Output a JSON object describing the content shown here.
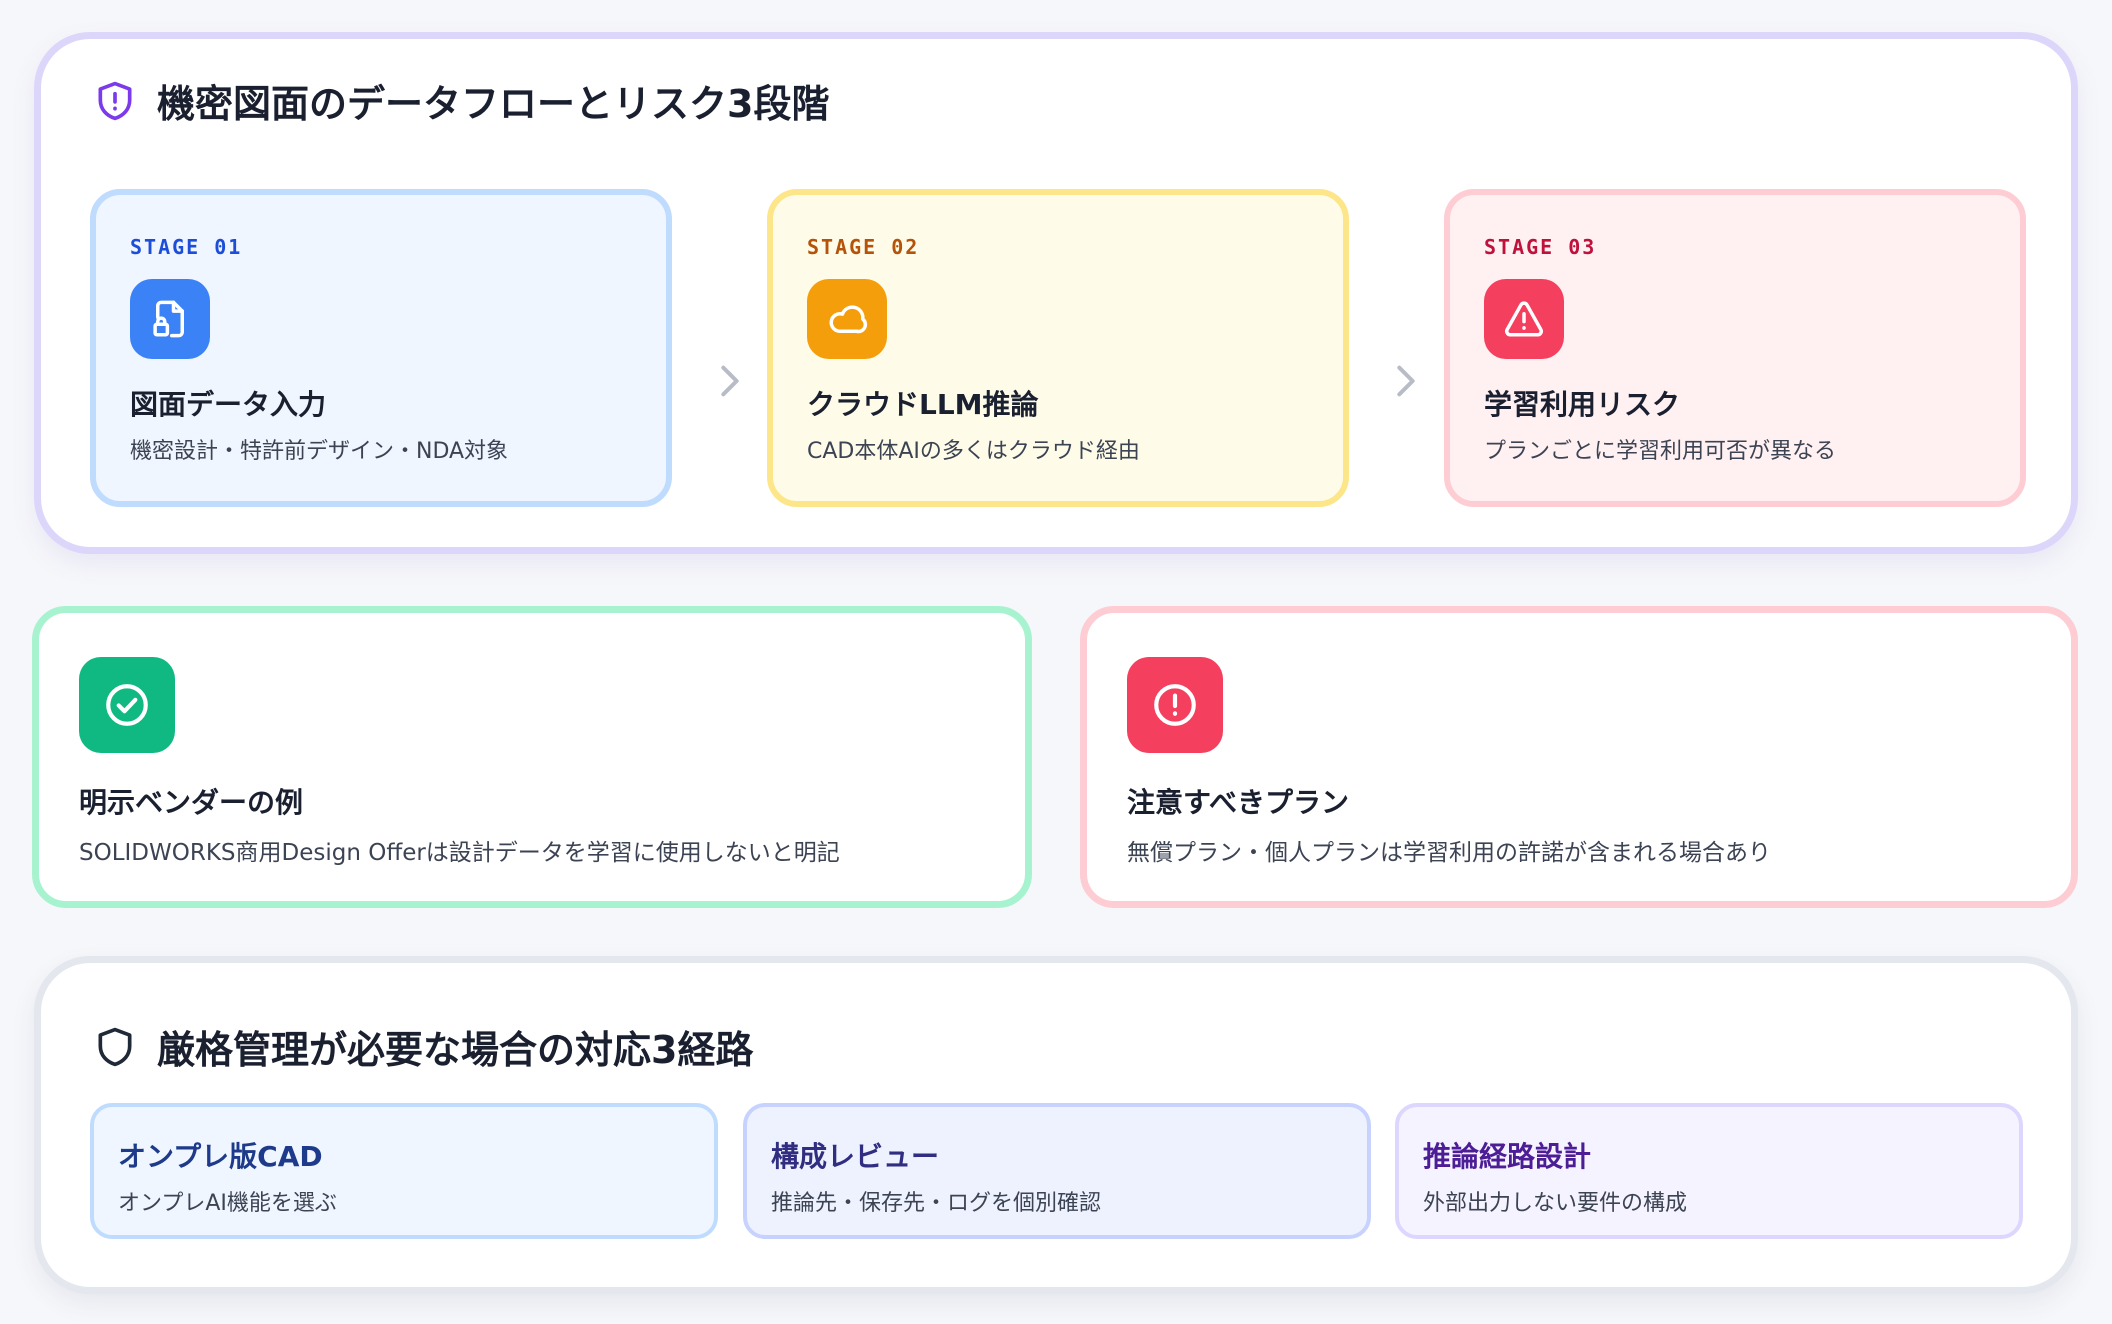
{
  "flow": {
    "title": "機密図面のデータフローとリスク3段階",
    "title_icon": "shield-alert-icon",
    "stages": [
      {
        "label": "STAGE 01",
        "icon": "file-lock-icon",
        "title": "図面データ入力",
        "desc": "機密設計・特許前デザイン・NDA対象",
        "accent": "#1d4ed8",
        "icon_bg": "#3b82f6",
        "bg": "#eff6ff",
        "border": "#bfdbfe"
      },
      {
        "label": "STAGE 02",
        "icon": "cloud-icon",
        "title": "クラウドLLM推論",
        "desc": "CAD本体AIの多くはクラウド経由",
        "accent": "#b45309",
        "icon_bg": "#f59e0b",
        "bg": "#fefce8",
        "border": "#fde68a"
      },
      {
        "label": "STAGE 03",
        "icon": "warning-triangle-icon",
        "title": "学習利用リスク",
        "desc": "プランごとに学習利用可否が異なる",
        "accent": "#be123c",
        "icon_bg": "#f43f5e",
        "bg": "#fff1f2",
        "border": "#fecdd3"
      }
    ]
  },
  "info": [
    {
      "icon": "check-circle-icon",
      "title": "明示ベンダーの例",
      "desc": "SOLIDWORKS商用Design Offerは設計データを学習に使用しないと明記",
      "icon_bg": "#10b981",
      "border": "#a7f3d0"
    },
    {
      "icon": "alert-circle-icon",
      "title": "注意すべきプラン",
      "desc": "無償プラン・個人プランは学習利用の許諾が含まれる場合あり",
      "icon_bg": "#f43f5e",
      "border": "#fecdd3"
    }
  ],
  "routes": {
    "title": "厳格管理が必要な場合の対応3経路",
    "title_icon": "shield-icon",
    "items": [
      {
        "title": "オンプレ版CAD",
        "desc": "オンプレAI機能を選ぶ",
        "title_color": "#1e3a8a",
        "bg": "#eff6ff",
        "border": "#bfdbfe"
      },
      {
        "title": "構成レビュー",
        "desc": "推論先・保存先・ログを個別確認",
        "title_color": "#312e81",
        "bg": "#eef2ff",
        "border": "#c7d2fe"
      },
      {
        "title": "推論経路設計",
        "desc": "外部出力しない要件の構成",
        "title_color": "#4c1d95",
        "bg": "#f5f3ff",
        "border": "#ddd6fe"
      }
    ]
  }
}
